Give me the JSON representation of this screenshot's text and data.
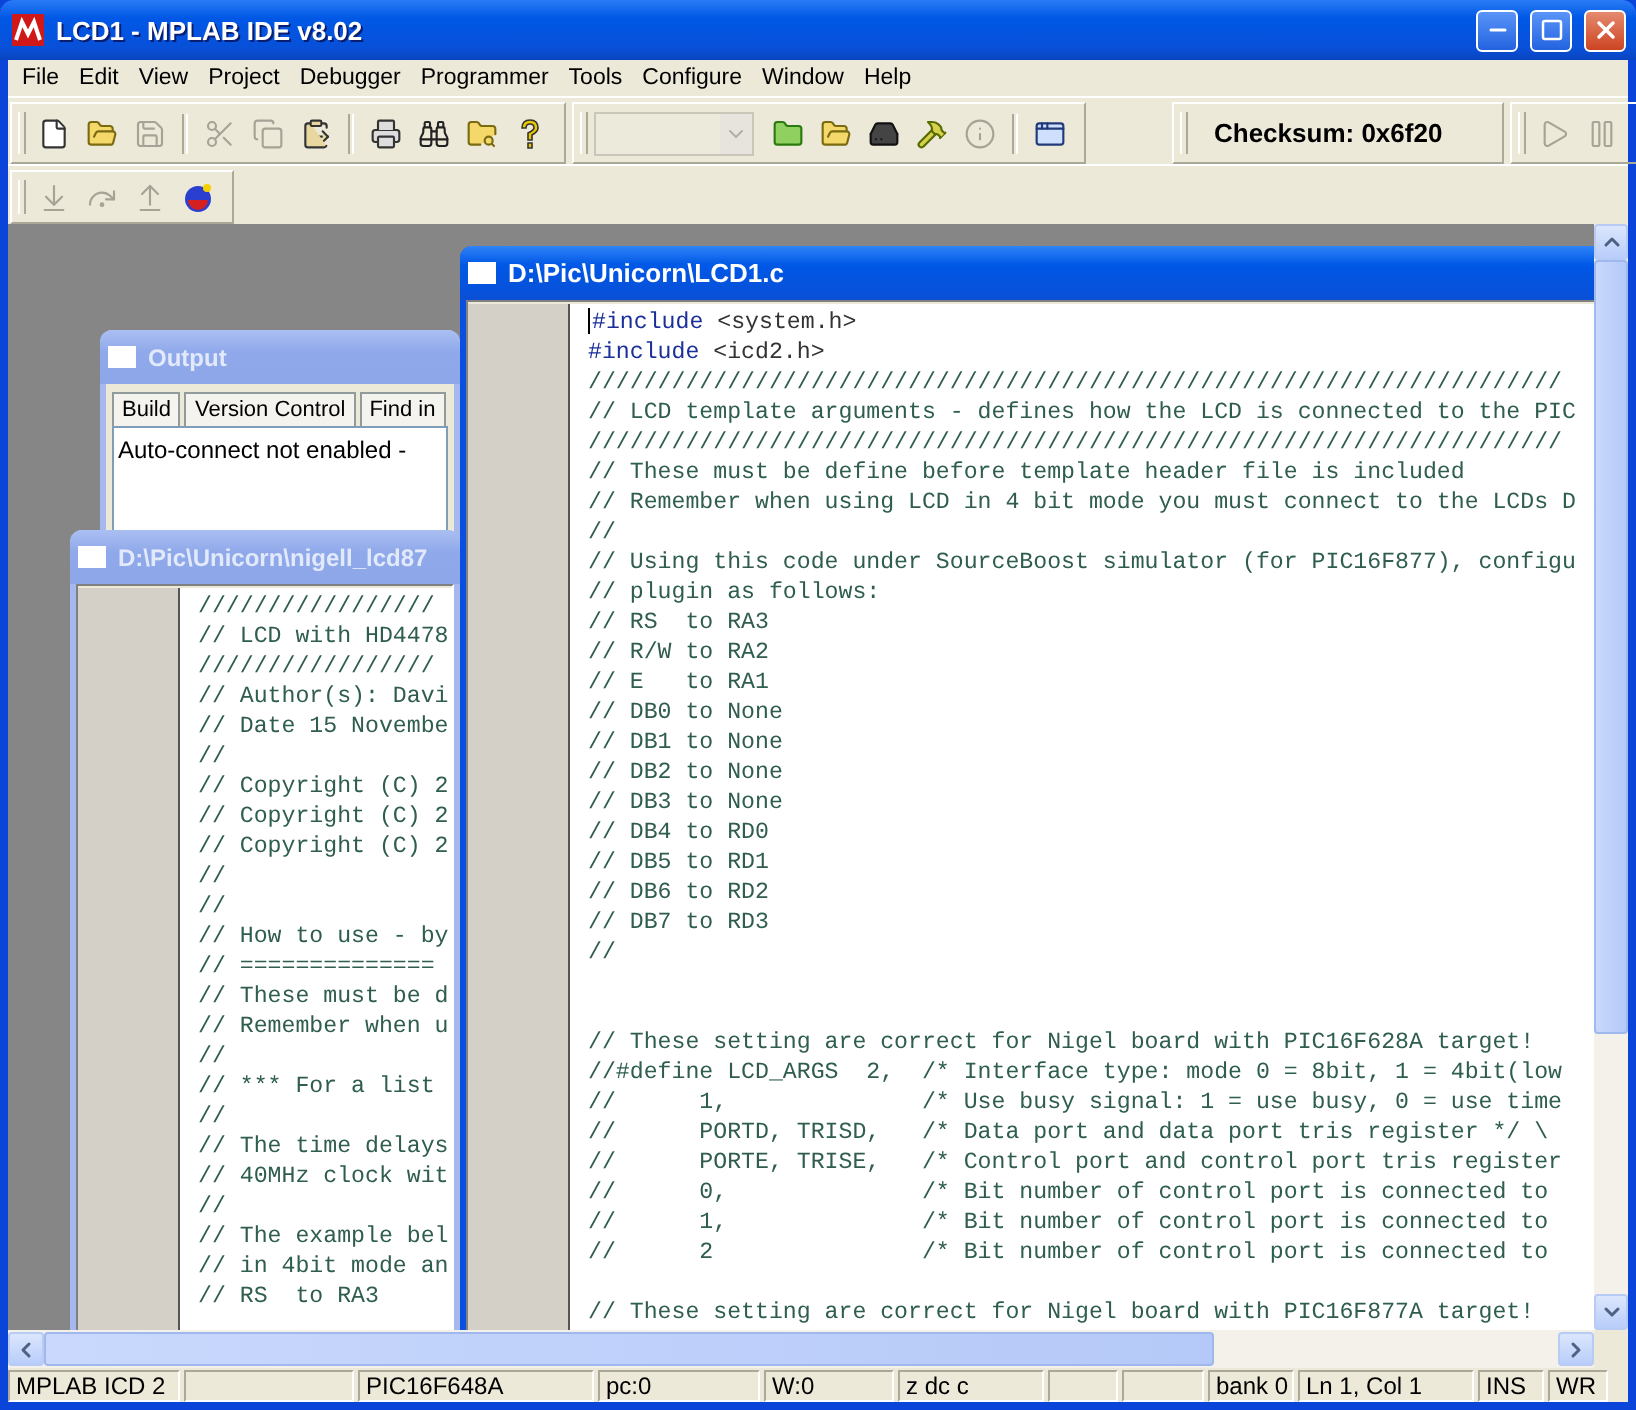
{
  "window": {
    "title": "LCD1 - MPLAB IDE v8.02"
  },
  "menu": [
    "File",
    "Edit",
    "View",
    "Project",
    "Debugger",
    "Programmer",
    "Tools",
    "Configure",
    "Window",
    "Help"
  ],
  "toolbar_rows": [
    {
      "bands": [
        {
          "kind": "buttons",
          "items": [
            {
              "kind": "new",
              "disabled": false
            },
            {
              "kind": "open",
              "disabled": false
            },
            {
              "kind": "save",
              "disabled": true
            },
            {
              "kind": "separator"
            },
            {
              "kind": "cut",
              "disabled": true
            },
            {
              "kind": "copy",
              "disabled": true
            },
            {
              "kind": "paste",
              "disabled": false
            },
            {
              "kind": "separator"
            },
            {
              "kind": "print",
              "disabled": false
            },
            {
              "kind": "find",
              "disabled": false
            },
            {
              "kind": "find-files",
              "disabled": false
            },
            {
              "kind": "help",
              "disabled": false
            }
          ]
        },
        {
          "kind": "buttons",
          "items": [
            {
              "kind": "dropdown",
              "disabled": true
            },
            {
              "kind": "new-project",
              "disabled": false
            },
            {
              "kind": "open",
              "disabled": false
            },
            {
              "kind": "save-project",
              "disabled": false
            },
            {
              "kind": "build",
              "disabled": false
            },
            {
              "kind": "info",
              "disabled": true
            },
            {
              "kind": "separator"
            },
            {
              "kind": "window",
              "disabled": false
            }
          ]
        },
        {
          "kind": "label",
          "text": "Checksum: 0x6f20"
        },
        {
          "kind": "buttons",
          "items": [
            {
              "kind": "run",
              "disabled": true
            },
            {
              "kind": "halt",
              "disabled": true
            }
          ]
        }
      ]
    },
    {
      "bands": [
        {
          "kind": "buttons",
          "items": [
            {
              "kind": "step-into",
              "disabled": true
            },
            {
              "kind": "step-over",
              "disabled": true
            },
            {
              "kind": "step-out",
              "disabled": true
            },
            {
              "kind": "ball",
              "disabled": false
            }
          ]
        }
      ]
    }
  ],
  "output_window": {
    "title": "Output",
    "active": false,
    "tabs": [
      {
        "label": "Build",
        "selected": false
      },
      {
        "label": "Version Control",
        "selected": false
      },
      {
        "label": "Find in",
        "selected": false
      }
    ],
    "text": "Auto-connect not enabled -"
  },
  "editors": [
    {
      "title": "D:\\Pic\\Unicorn\\nigell_lcd87",
      "active": false,
      "lines": [
        {
          "kind": "comment",
          "text": "/////////////////"
        },
        {
          "kind": "comment",
          "text": "// LCD with HD4478"
        },
        {
          "kind": "comment",
          "text": "/////////////////"
        },
        {
          "kind": "comment",
          "text": "// Author(s): Davi"
        },
        {
          "kind": "comment",
          "text": "// Date 15 Novembe"
        },
        {
          "kind": "comment",
          "text": "//"
        },
        {
          "kind": "comment",
          "text": "// Copyright (C) 2"
        },
        {
          "kind": "comment",
          "text": "// Copyright (C) 2"
        },
        {
          "kind": "comment",
          "text": "// Copyright (C) 2"
        },
        {
          "kind": "comment",
          "text": "//"
        },
        {
          "kind": "comment",
          "text": "//"
        },
        {
          "kind": "comment",
          "text": "// How to use - by"
        },
        {
          "kind": "comment",
          "text": "// =============="
        },
        {
          "kind": "comment",
          "text": "// These must be d"
        },
        {
          "kind": "comment",
          "text": "// Remember when u"
        },
        {
          "kind": "comment",
          "text": "//"
        },
        {
          "kind": "comment",
          "text": "// *** For a list"
        },
        {
          "kind": "comment",
          "text": "//"
        },
        {
          "kind": "comment",
          "text": "// The time delays"
        },
        {
          "kind": "comment",
          "text": "// 40MHz clock wit"
        },
        {
          "kind": "comment",
          "text": "//"
        },
        {
          "kind": "comment",
          "text": "// The example bel"
        },
        {
          "kind": "comment",
          "text": "// in 4bit mode an"
        },
        {
          "kind": "comment",
          "text": "// RS  to RA3"
        }
      ]
    },
    {
      "title": "D:\\Pic\\Unicorn\\LCD1.c",
      "active": true,
      "lines": [
        {
          "kind": "include",
          "directive": "#include",
          "arg": "<system.h>"
        },
        {
          "kind": "include",
          "directive": "#include",
          "arg": "<icd2.h>"
        },
        {
          "kind": "comment",
          "text": "//////////////////////////////////////////////////////////////////////"
        },
        {
          "kind": "comment",
          "text": "// LCD template arguments - defines how the LCD is connected to the PIC"
        },
        {
          "kind": "comment",
          "text": "//////////////////////////////////////////////////////////////////////"
        },
        {
          "kind": "comment",
          "text": "// These must be define before template header file is included"
        },
        {
          "kind": "comment",
          "text": "// Remember when using LCD in 4 bit mode you must connect to the LCDs D"
        },
        {
          "kind": "comment",
          "text": "//"
        },
        {
          "kind": "comment",
          "text": "// Using this code under SourceBoost simulator (for PIC16F877), configu"
        },
        {
          "kind": "comment",
          "text": "// plugin as follows:"
        },
        {
          "kind": "comment",
          "text": "// RS  to RA3"
        },
        {
          "kind": "comment",
          "text": "// R/W to RA2"
        },
        {
          "kind": "comment",
          "text": "// E   to RA1"
        },
        {
          "kind": "comment",
          "text": "// DB0 to None"
        },
        {
          "kind": "comment",
          "text": "// DB1 to None"
        },
        {
          "kind": "comment",
          "text": "// DB2 to None"
        },
        {
          "kind": "comment",
          "text": "// DB3 to None"
        },
        {
          "kind": "comment",
          "text": "// DB4 to RD0"
        },
        {
          "kind": "comment",
          "text": "// DB5 to RD1"
        },
        {
          "kind": "comment",
          "text": "// DB6 to RD2"
        },
        {
          "kind": "comment",
          "text": "// DB7 to RD3"
        },
        {
          "kind": "comment",
          "text": "//"
        },
        {
          "kind": "blank"
        },
        {
          "kind": "blank"
        },
        {
          "kind": "comment",
          "text": "// These setting are correct for Nigel board with PIC16F628A target!"
        },
        {
          "kind": "comment",
          "text": "//#define LCD_ARGS  2,  /* Interface type: mode 0 = 8bit, 1 = 4bit(low"
        },
        {
          "kind": "comment",
          "text": "//      1,              /* Use busy signal: 1 = use busy, 0 = use time"
        },
        {
          "kind": "comment",
          "text": "//      PORTD, TRISD,   /* Data port and data port tris register */ \\"
        },
        {
          "kind": "comment",
          "text": "//      PORTE, TRISE,   /* Control port and control port tris register"
        },
        {
          "kind": "comment",
          "text": "//      0,              /* Bit number of control port is connected to"
        },
        {
          "kind": "comment",
          "text": "//      1,              /* Bit number of control port is connected to"
        },
        {
          "kind": "comment",
          "text": "//      2               /* Bit number of control port is connected to"
        },
        {
          "kind": "blank"
        },
        {
          "kind": "comment",
          "text": "// These setting are correct for Nigel board with PIC16F877A target!"
        }
      ]
    }
  ],
  "status_bar": [
    {
      "kind": "text",
      "text": "MPLAB ICD 2"
    },
    {
      "kind": "empty"
    },
    {
      "kind": "text",
      "text": "PIC16F648A"
    },
    {
      "kind": "text",
      "text": "pc:0"
    },
    {
      "kind": "text",
      "text": "W:0"
    },
    {
      "kind": "text",
      "text": "z dc c"
    },
    {
      "kind": "empty"
    },
    {
      "kind": "empty"
    },
    {
      "kind": "text",
      "text": "bank 0"
    },
    {
      "kind": "text",
      "text": "Ln 1, Col 1"
    },
    {
      "kind": "text",
      "text": "INS"
    },
    {
      "kind": "text",
      "text": "WR"
    }
  ]
}
